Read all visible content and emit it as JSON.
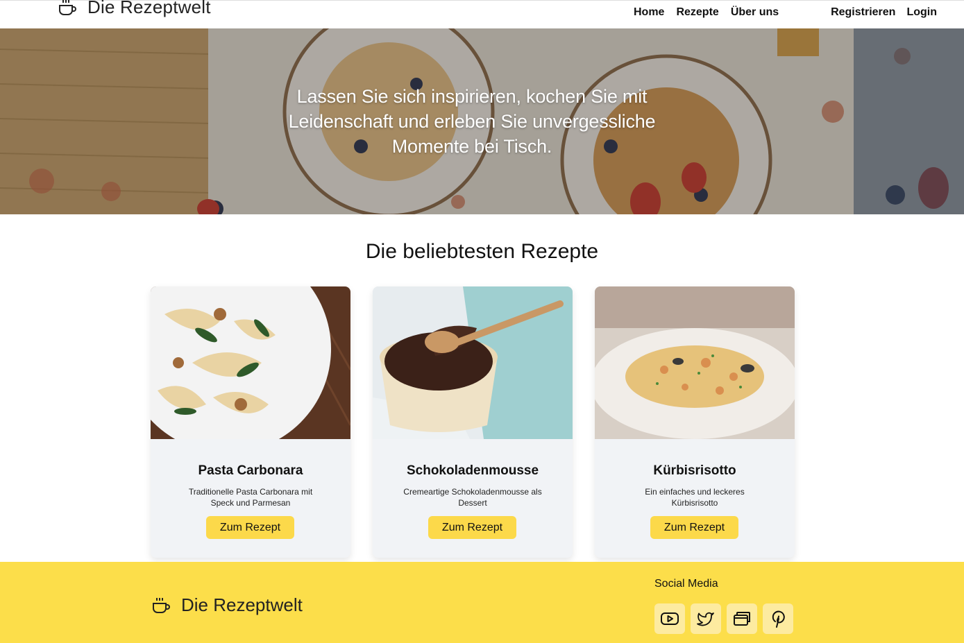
{
  "nav": {
    "brand": "Die Rezeptwelt",
    "links": [
      "Home",
      "Rezepte",
      "Über uns"
    ],
    "right": [
      "Registrieren",
      "Login"
    ]
  },
  "hero": {
    "headline": "Lassen Sie sich inspirieren, kochen Sie mit Leidenschaft und erleben Sie unvergessliche Momente bei Tisch."
  },
  "section": {
    "title": "Die beliebtesten Rezepte"
  },
  "cards": [
    {
      "title": "Pasta Carbonara",
      "description": "Traditionelle Pasta Carbonara mit Speck und Parmesan",
      "button": "Zum Rezept",
      "image_icon": "pasta-photo"
    },
    {
      "title": "Schokoladenmousse",
      "description": "Cremeartige Schokoladenmousse als Dessert",
      "button": "Zum Rezept",
      "image_icon": "chocolate-mousse-photo"
    },
    {
      "title": "Kürbisrisotto",
      "description": "Ein einfaches und leckeres Kürbisrisotto",
      "button": "Zum Rezept",
      "image_icon": "risotto-photo"
    }
  ],
  "footer": {
    "brand": "Die Rezeptwelt",
    "social_title": "Social Media",
    "social_icons": [
      "youtube-icon",
      "twitter-icon",
      "gallery-icon",
      "pinterest-icon"
    ]
  },
  "colors": {
    "accent": "#fcd94a",
    "footer_bg": "#fcde4a",
    "card_bg": "#f1f3f6"
  }
}
